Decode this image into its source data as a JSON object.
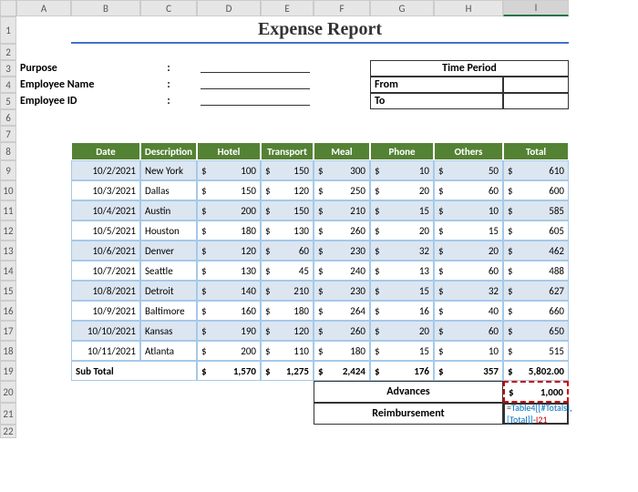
{
  "cols": [
    "A",
    "B",
    "C",
    "D",
    "E",
    "F",
    "G",
    "H",
    "I"
  ],
  "rows": [
    "1",
    "2",
    "3",
    "4",
    "5",
    "6",
    "7",
    "8",
    "9",
    "10",
    "11",
    "12",
    "13",
    "14",
    "15",
    "16",
    "17",
    "18",
    "19",
    "20",
    "21",
    "22"
  ],
  "selectedCol": "I",
  "title": "Expense Report",
  "labels": {
    "purpose": "Purpose",
    "empName": "Employee Name",
    "empId": "Employee ID",
    "colon": ":"
  },
  "timePeriod": {
    "header": "Time Period",
    "from": "From",
    "to": "To"
  },
  "headers": [
    "Date",
    "Description",
    "Hotel",
    "Transport",
    "Meal",
    "Phone",
    "Others",
    "Total"
  ],
  "data": [
    {
      "date": "10/2/2021",
      "desc": "New York",
      "hotel": "100",
      "transport": "150",
      "meal": "300",
      "phone": "10",
      "others": "50",
      "total": "610"
    },
    {
      "date": "10/3/2021",
      "desc": "Dallas",
      "hotel": "150",
      "transport": "120",
      "meal": "250",
      "phone": "20",
      "others": "60",
      "total": "600"
    },
    {
      "date": "10/4/2021",
      "desc": "Austin",
      "hotel": "200",
      "transport": "150",
      "meal": "210",
      "phone": "15",
      "others": "10",
      "total": "585"
    },
    {
      "date": "10/5/2021",
      "desc": "Houston",
      "hotel": "180",
      "transport": "130",
      "meal": "260",
      "phone": "20",
      "others": "15",
      "total": "605"
    },
    {
      "date": "10/6/2021",
      "desc": "Denver",
      "hotel": "120",
      "transport": "60",
      "meal": "230",
      "phone": "32",
      "others": "20",
      "total": "462"
    },
    {
      "date": "10/7/2021",
      "desc": "Seattle",
      "hotel": "130",
      "transport": "45",
      "meal": "240",
      "phone": "13",
      "others": "60",
      "total": "488"
    },
    {
      "date": "10/8/2021",
      "desc": "Detroit",
      "hotel": "140",
      "transport": "210",
      "meal": "230",
      "phone": "15",
      "others": "32",
      "total": "627"
    },
    {
      "date": "10/9/2021",
      "desc": "Baltimore",
      "hotel": "160",
      "transport": "180",
      "meal": "264",
      "phone": "16",
      "others": "40",
      "total": "660"
    },
    {
      "date": "10/10/2021",
      "desc": "Kansas",
      "hotel": "190",
      "transport": "120",
      "meal": "260",
      "phone": "20",
      "others": "60",
      "total": "650"
    },
    {
      "date": "10/11/2021",
      "desc": "Atlanta",
      "hotel": "200",
      "transport": "110",
      "meal": "180",
      "phone": "15",
      "others": "10",
      "total": "515"
    }
  ],
  "subtotal": {
    "label": "Sub Total",
    "hotel": "1,570",
    "transport": "1,275",
    "meal": "2,424",
    "phone": "176",
    "others": "357",
    "total": "5,802.00"
  },
  "advances": {
    "label": "Advances",
    "value": "1,000"
  },
  "reimbursement": {
    "label": "Reimbursement",
    "formula": "=Table4[[#Totals],[Total]]-I21"
  },
  "currency": "$"
}
